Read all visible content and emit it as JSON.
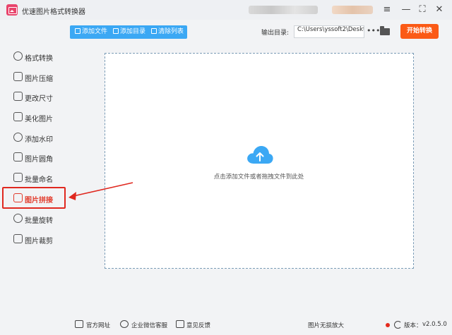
{
  "window": {
    "title": "优速图片格式转换器",
    "controls": [
      "≡",
      "—",
      "⛶",
      "✕"
    ]
  },
  "sidebar": {
    "items": [
      {
        "label": "格式转换",
        "icon": "format-convert-icon",
        "active": false
      },
      {
        "label": "图片压缩",
        "icon": "compress-icon",
        "active": false
      },
      {
        "label": "更改尺寸",
        "icon": "resize-icon",
        "active": false
      },
      {
        "label": "美化图片",
        "icon": "beautify-icon",
        "active": false
      },
      {
        "label": "添加水印",
        "icon": "watermark-icon",
        "active": false
      },
      {
        "label": "图片圆角",
        "icon": "rounded-corner-icon",
        "active": false
      },
      {
        "label": "批量命名",
        "icon": "rename-icon",
        "active": false
      },
      {
        "label": "图片拼接",
        "icon": "stitch-icon",
        "active": true
      },
      {
        "label": "批量旋转",
        "icon": "rotate-icon",
        "active": false
      },
      {
        "label": "图片裁剪",
        "icon": "crop-icon",
        "active": false
      }
    ]
  },
  "toolbar": {
    "add_file": "添加文件",
    "add_folder": "添加目录",
    "clear_list": "清除列表",
    "output_label": "输出目录:",
    "output_path": "C:\\Users\\yssoft2\\Deskt",
    "more": "•••",
    "start": "开始转换"
  },
  "dropzone": {
    "hint": "点击添加文件或者拖拽文件到此处"
  },
  "statusbar": {
    "website": "官方网址",
    "wechat": "企业微信客服",
    "feedback": "意见反馈",
    "lossless": "图片无损放大",
    "version_label": "版本：",
    "version": "v2.0.5.0"
  },
  "colors": {
    "accent_blue": "#3ba8f4",
    "start_orange": "#fb5a16",
    "highlight_red": "#e0281f"
  }
}
